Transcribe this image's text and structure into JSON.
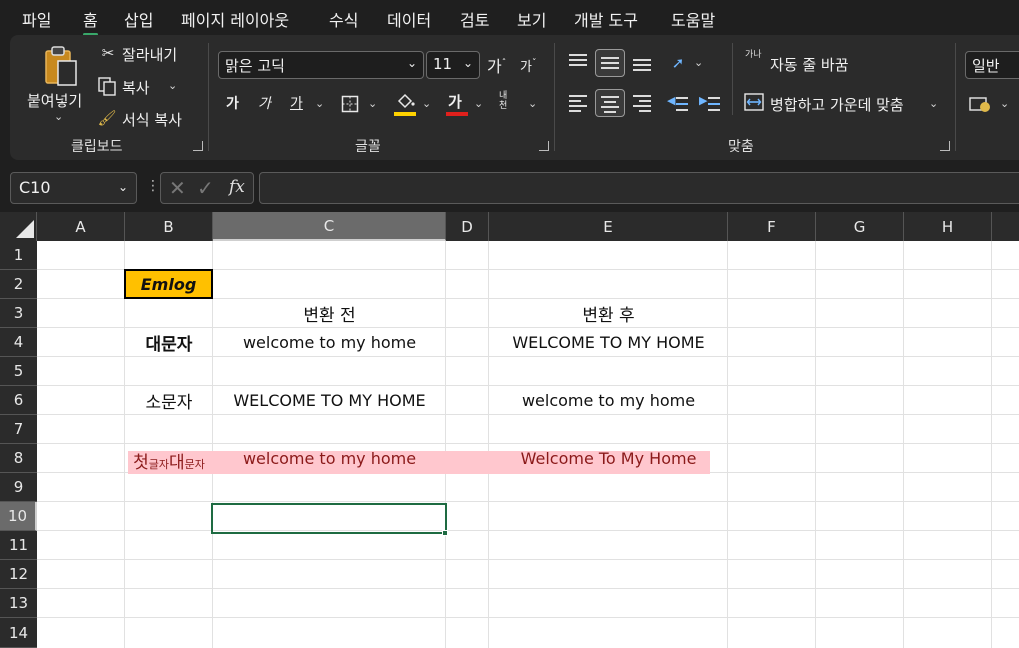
{
  "menu": {
    "items": [
      "파일",
      "홈",
      "삽입",
      "페이지 레이아웃",
      "수식",
      "데이터",
      "검토",
      "보기",
      "개발 도구",
      "도움말"
    ],
    "active": "홈"
  },
  "ribbon": {
    "clipboard": {
      "paste": "붙여넣기",
      "cut": "잘라내기",
      "copy": "복사",
      "format_painter": "서식 복사",
      "label": "클립보드"
    },
    "font": {
      "name": "맑은 고딕",
      "size": "11",
      "grow": "가",
      "shrink": "가",
      "bold": "가",
      "italic": "가",
      "underline": "가",
      "font_color_glyph": "가",
      "phonetic": "내천",
      "label": "글꼴",
      "highlight_color": "#ffd200",
      "font_color": "#e0201c"
    },
    "alignment": {
      "wrap_text": "자동 줄 바꿈",
      "merge_center": "병합하고 가운데 맞춤",
      "wrap_icon_glyph": "가나",
      "label": "맞춤"
    },
    "number": {
      "format": "일반"
    }
  },
  "formula_bar": {
    "name_box": "C10",
    "fx": "fx",
    "formula": ""
  },
  "sheet": {
    "columns": [
      "A",
      "B",
      "C",
      "D",
      "E",
      "F",
      "G",
      "H"
    ],
    "rows": [
      "1",
      "2",
      "3",
      "4",
      "5",
      "6",
      "7",
      "8",
      "9",
      "10",
      "11",
      "12",
      "13",
      "14"
    ],
    "selected_cell": "C10",
    "cells": {
      "B2": "Emlog",
      "C3": "변환 전",
      "E3": "변환 후",
      "B4": "대문자",
      "C4": "welcome to my home",
      "E4": "WELCOME TO MY HOME",
      "B6": "소문자",
      "C6": "WELCOME TO MY HOME",
      "E6": "welcome to my home",
      "B8_big1": "첫",
      "B8_small1": "글자 ",
      "B8_big2": "대",
      "B8_small2": "문자",
      "C8": "welcome to my home",
      "E8": "Welcome To My Home"
    },
    "colors": {
      "emlog_fill": "#ffc000",
      "highlight_fill": "#ffc7ce",
      "selection": "#1e6b42"
    }
  }
}
